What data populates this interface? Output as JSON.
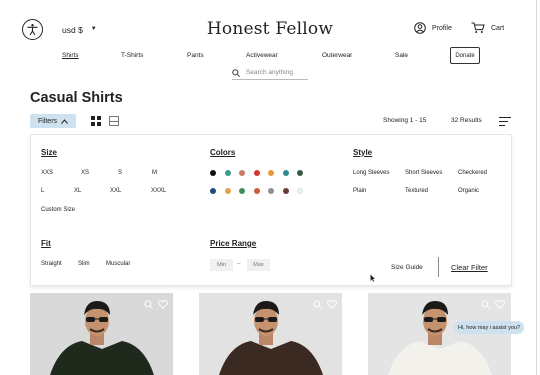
{
  "header": {
    "currency": "usd $",
    "currency_caret": "▼",
    "brand": "Honest Fellow",
    "profile_label": "Profile",
    "cart_label": "Cart"
  },
  "nav": {
    "items": [
      "Shirts",
      "T-Shirts",
      "Pants",
      "Activewear",
      "Outerwear",
      "Sale"
    ],
    "active": "Shirts",
    "donate": "Donate"
  },
  "search": {
    "placeholder": "Search anything"
  },
  "page": {
    "title": "Casual Shirts",
    "filters_label": "Filters",
    "showing": "Showing 1 - 15",
    "results": "32 Results"
  },
  "filters": {
    "size": {
      "title": "Size",
      "options": [
        "XXS",
        "XS",
        "S",
        "M",
        "L",
        "XL",
        "XXL",
        "XXXL",
        "Custom Size"
      ]
    },
    "colors": {
      "title": "Colors",
      "swatches": [
        "#111111",
        "#3a9a8d",
        "#c97b6b",
        "#d23a2f",
        "#e79a2e",
        "#2c8a90",
        "#3b5a44",
        "#1d4f7a",
        "#e0a34a",
        "#3f8f5e",
        "#cf5a3a",
        "#8e8e8e",
        "#6a3a33",
        "#eeeeee"
      ]
    },
    "style": {
      "title": "Style",
      "options": [
        "Long Sleeves",
        "Short Sleeves",
        "Checkered",
        "Plain",
        "Textured",
        "Organic"
      ]
    },
    "fit": {
      "title": "Fit",
      "options": [
        "Straight",
        "Slim",
        "Muscular"
      ]
    },
    "price": {
      "title": "Price Range",
      "min_placeholder": "Min",
      "separator": "–",
      "max_placeholder": "Max"
    },
    "size_guide": "Size Guide",
    "clear": "Clear Filter"
  },
  "chat": {
    "message": "Hi, how may i assist you?"
  },
  "products": [
    {
      "shirt_color": "#1f2a1c",
      "background": "#d9d9d9"
    },
    {
      "shirt_color": "#3a2a22",
      "background": "#e2e2e2"
    },
    {
      "shirt_color": "#f2f1ec",
      "background": "#e4e4e4"
    }
  ]
}
